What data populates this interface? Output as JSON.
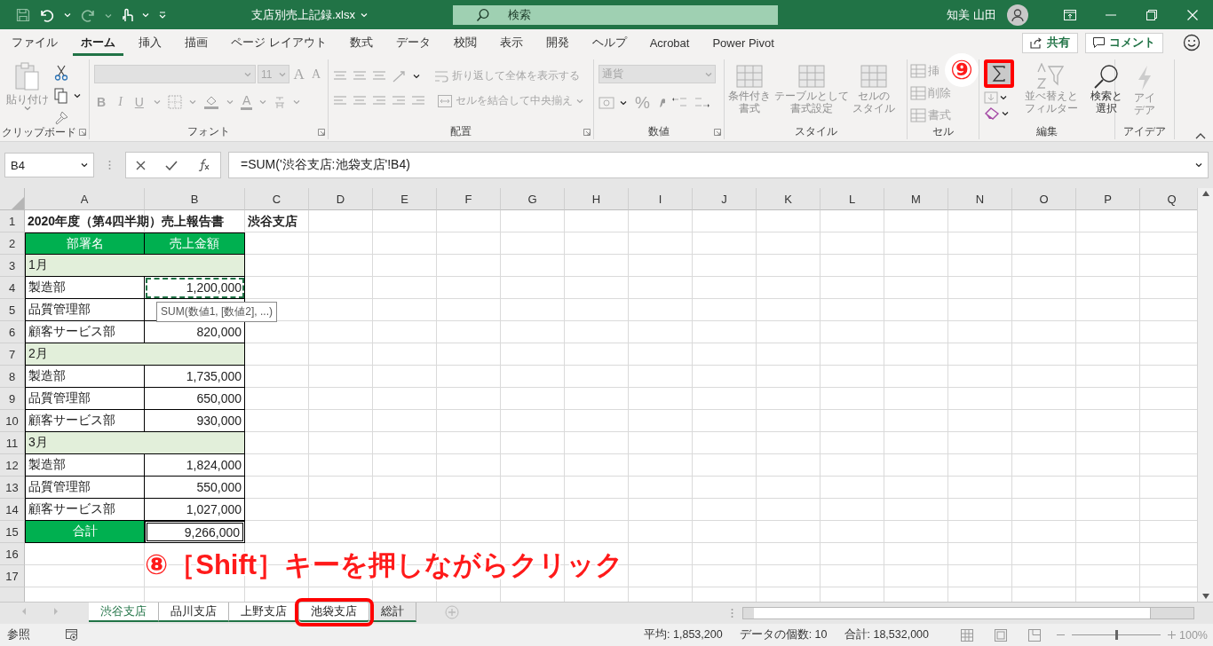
{
  "title_bar": {
    "file_name": "支店別売上記録.xlsx",
    "search_placeholder": "検索",
    "user_name": "知美 山田"
  },
  "ribbon_tabs": [
    {
      "label": "ファイル",
      "selected": false
    },
    {
      "label": "ホーム",
      "selected": true
    },
    {
      "label": "挿入",
      "selected": false
    },
    {
      "label": "描画",
      "selected": false
    },
    {
      "label": "ページ レイアウト",
      "selected": false
    },
    {
      "label": "数式",
      "selected": false
    },
    {
      "label": "データ",
      "selected": false
    },
    {
      "label": "校閲",
      "selected": false
    },
    {
      "label": "表示",
      "selected": false
    },
    {
      "label": "開発",
      "selected": false
    },
    {
      "label": "ヘルプ",
      "selected": false
    },
    {
      "label": "Acrobat",
      "selected": false
    },
    {
      "label": "Power Pivot",
      "selected": false
    }
  ],
  "share_button": "共有",
  "comment_button": "コメント",
  "ribbon": {
    "clipboard": {
      "label": "クリップボード",
      "paste": "貼り付け"
    },
    "font": {
      "label": "フォント",
      "size": "11",
      "grow": "A",
      "shrink": "A",
      "bold": "B",
      "italic": "I",
      "underline": "U",
      "font_color": "A"
    },
    "alignment": {
      "label": "配置",
      "wrap_text": "折り返して全体を表示する",
      "merge_center": "セルを結合して中央揃え"
    },
    "number": {
      "label": "数値",
      "format": "通貨",
      "percent": "%"
    },
    "styles": {
      "label": "スタイル",
      "buttons": [
        [
          "条件付き",
          "書式"
        ],
        [
          "テーブルとして",
          "書式設定"
        ],
        [
          "セルの",
          "スタイル"
        ]
      ]
    },
    "cells": {
      "label": "セル",
      "buttons": [
        "挿",
        "削除",
        "書式"
      ]
    },
    "editing": {
      "label": "編集",
      "autosum_highlighted": true,
      "sort_filter": [
        "並べ替えと",
        "フィルター"
      ],
      "find_select": [
        "検索と",
        "選択"
      ]
    },
    "ideas": {
      "label": "アイデア",
      "button": [
        "アイ",
        "デア"
      ]
    }
  },
  "name_box": "B4",
  "formula": "=SUM('渋谷支店:池袋支店'!B4)",
  "columns": [
    "A",
    "B",
    "C",
    "D",
    "E",
    "F",
    "G",
    "H",
    "I",
    "J",
    "K",
    "L",
    "M",
    "N",
    "O",
    "P",
    "Q"
  ],
  "rows": [
    {
      "number": "1",
      "kind": "title",
      "a": "2020年度（第4四半期）売上報告書",
      "c": "渋谷支店"
    },
    {
      "number": "2",
      "kind": "header",
      "a": "部署名",
      "b": "売上金額"
    },
    {
      "number": "3",
      "kind": "month",
      "a": "1月"
    },
    {
      "number": "4",
      "kind": "data",
      "a": "製造部",
      "b": "1,200,000",
      "selected": true
    },
    {
      "number": "5",
      "kind": "data",
      "a": "品質管理部",
      "selected": false
    },
    {
      "number": "6",
      "kind": "data",
      "a": "顧客サービス部",
      "b": "820,000",
      "selected": false
    },
    {
      "number": "7",
      "kind": "month",
      "a": "2月"
    },
    {
      "number": "8",
      "kind": "data",
      "a": "製造部",
      "b": "1,735,000",
      "selected": false
    },
    {
      "number": "9",
      "kind": "data",
      "a": "品質管理部",
      "b": "650,000",
      "selected": false
    },
    {
      "number": "10",
      "kind": "data",
      "a": "顧客サービス部",
      "b": "930,000",
      "selected": false
    },
    {
      "number": "11",
      "kind": "month",
      "a": "3月"
    },
    {
      "number": "12",
      "kind": "data",
      "a": "製造部",
      "b": "1,824,000",
      "selected": false
    },
    {
      "number": "13",
      "kind": "data",
      "a": "品質管理部",
      "b": "550,000",
      "selected": false
    },
    {
      "number": "14",
      "kind": "data",
      "a": "顧客サービス部",
      "b": "1,027,000",
      "selected": false
    },
    {
      "number": "15",
      "kind": "total",
      "a": "合計",
      "b": "9,266,000"
    },
    {
      "number": "16",
      "kind": "empty"
    },
    {
      "number": "17",
      "kind": "empty"
    }
  ],
  "tooltip": "SUM(数値1, [数値2], ...)",
  "sheet_tabs": [
    {
      "label": "渋谷支店",
      "selected": true,
      "active": true,
      "highlighted": false
    },
    {
      "label": "品川支店",
      "selected": true,
      "active": false,
      "highlighted": false
    },
    {
      "label": "上野支店",
      "selected": true,
      "active": false,
      "highlighted": false
    },
    {
      "label": "池袋支店",
      "selected": true,
      "active": false,
      "highlighted": true
    },
    {
      "label": "総計",
      "selected": false,
      "active": false,
      "highlighted": false
    }
  ],
  "status_bar": {
    "mode": "参照",
    "average": "平均: 1,853,200",
    "count": "データの個数: 10",
    "sum": "合計: 18,532,000",
    "zoom": "100%",
    "zoom_slider": {
      "level": 0.5
    }
  },
  "annotations": {
    "step_9": "⑨",
    "step_8": "⑧［Shift］キーを押しながらクリック"
  }
}
